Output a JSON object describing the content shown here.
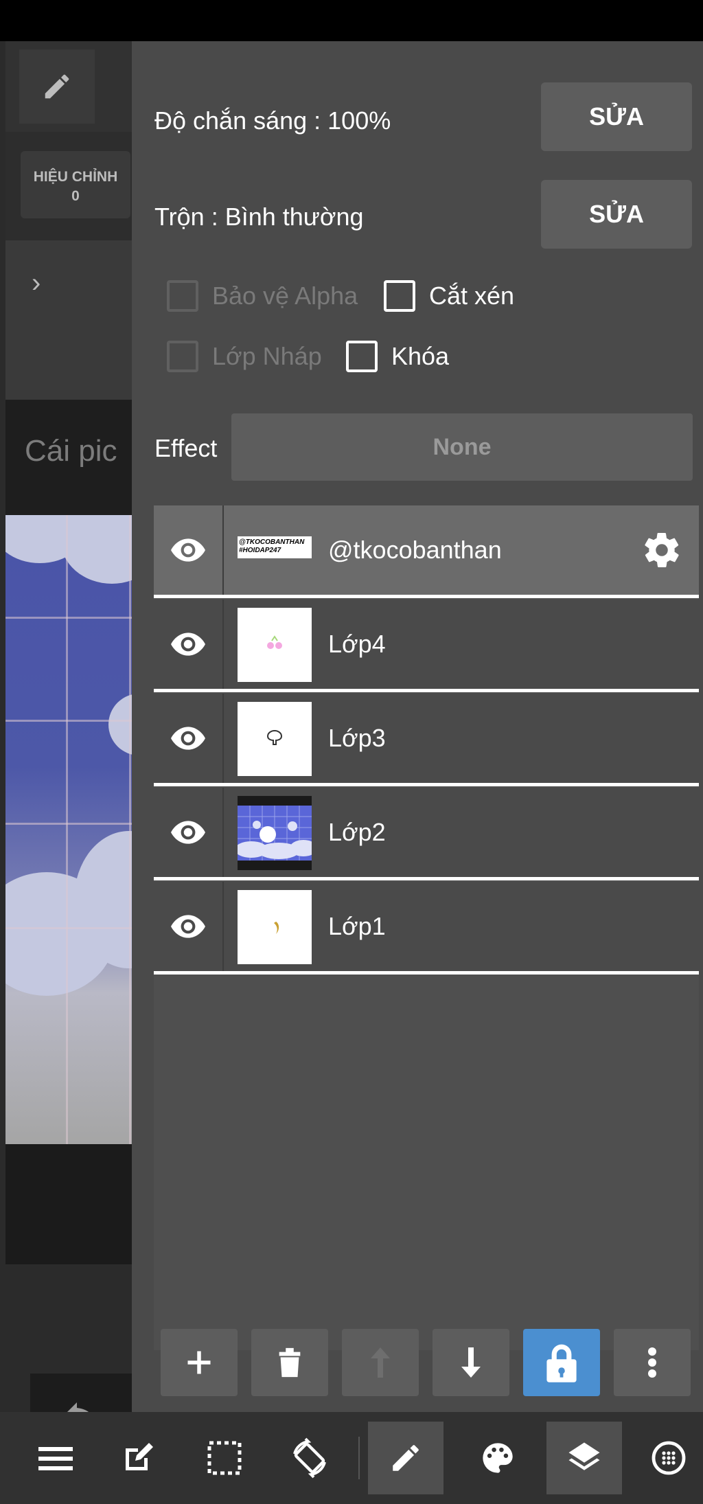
{
  "background": {
    "hieu_chinh_label": "HIỆU CHỈNH",
    "hieu_chinh_value": "0",
    "doc_text": "Cái pic"
  },
  "panel": {
    "opacity_label": "Độ chắn sáng : 100%",
    "opacity_edit": "SỬA",
    "blend_label": "Trộn : Bình thường",
    "blend_edit": "SỬA",
    "checkboxes": [
      {
        "label": "Bảo vệ Alpha",
        "checked": false,
        "enabled": false
      },
      {
        "label": "Cắt xén",
        "checked": false,
        "enabled": true
      },
      {
        "label": "Lớp Nháp",
        "checked": false,
        "enabled": false
      },
      {
        "label": "Khóa",
        "checked": false,
        "enabled": true
      }
    ],
    "effect_label": "Effect",
    "effect_value": "None"
  },
  "layers": [
    {
      "name": "@tkocobanthan",
      "thumb_text": "@TKOCOBANTHAN #HOIDAP247",
      "selected": true,
      "visible": true
    },
    {
      "name": "Lớp4",
      "selected": false,
      "visible": true
    },
    {
      "name": "Lớp3",
      "selected": false,
      "visible": true
    },
    {
      "name": "Lớp2",
      "selected": false,
      "visible": true
    },
    {
      "name": "Lớp1",
      "selected": false,
      "visible": true
    }
  ],
  "layer_actions": [
    "add-layer",
    "delete-layer",
    "move-layer-up",
    "move-layer-down",
    "lock-layer",
    "more-options"
  ],
  "bottom_bar": [
    "menu-icon",
    "edit-icon",
    "selection-icon",
    "rotate-icon",
    "brush-icon",
    "palette-icon",
    "layers-icon",
    "navigator-icon"
  ],
  "colors": {
    "panel_bg": "#4a4a4a",
    "button_bg": "#5d5d5d",
    "selected_layer_bg": "#6b6b6b",
    "active_blue": "#4b8fd0"
  }
}
